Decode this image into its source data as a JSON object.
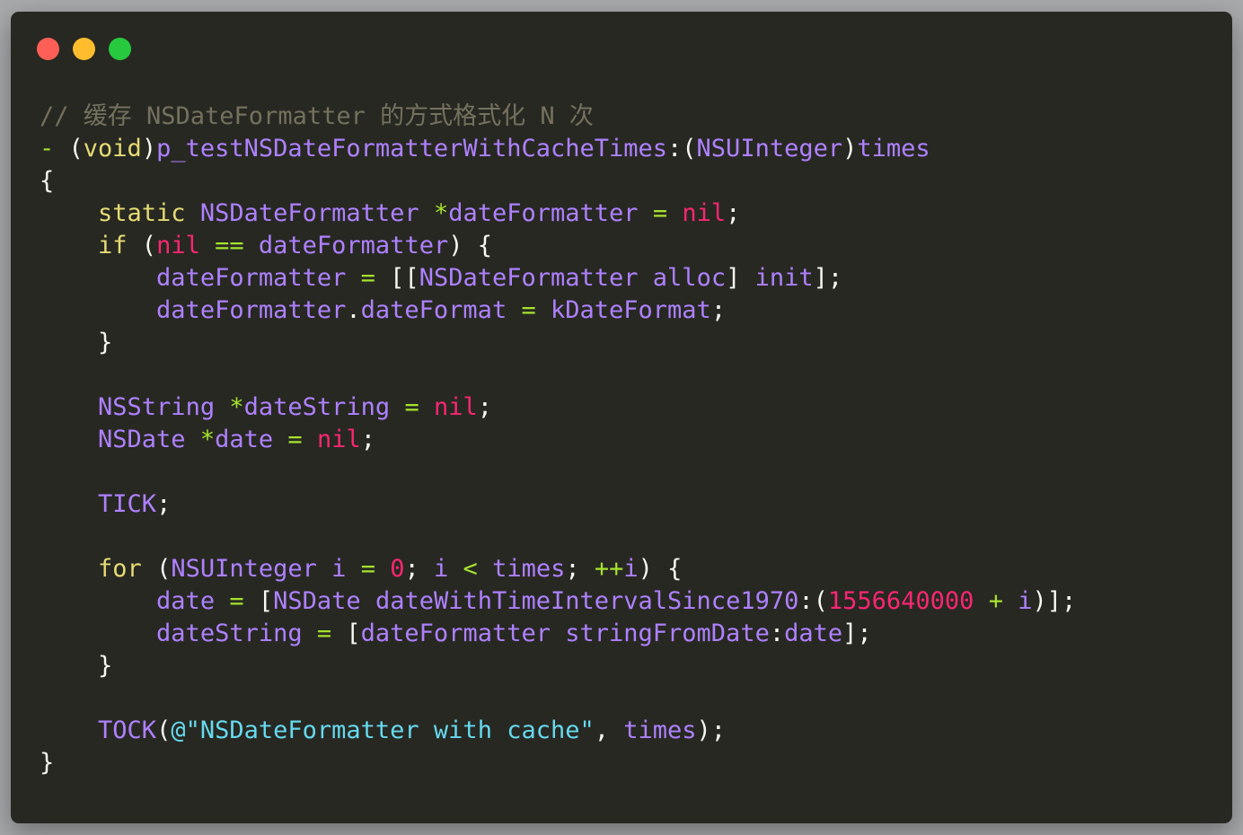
{
  "window": {
    "traffic_lights": {
      "close_color": "#ff5f56",
      "minimize_color": "#ffbd2e",
      "maximize_color": "#27c93f"
    }
  },
  "colors": {
    "background": "#272822",
    "comment": "#75715e",
    "keyword": "#e6db74",
    "storage": "#a6e22e",
    "type": "#ae81ff",
    "nil": "#f92672",
    "string": "#66d9ef",
    "default": "#f8f8f2"
  },
  "code": {
    "lines": [
      [
        {
          "t": "comment",
          "v": "// 缓存 NSDateFormatter 的方式格式化 N 次"
        }
      ],
      [
        {
          "t": "op",
          "v": "-"
        },
        {
          "t": "punct",
          "v": " ("
        },
        {
          "t": "keyword",
          "v": "void"
        },
        {
          "t": "punct",
          "v": ")"
        },
        {
          "t": "method",
          "v": "p_testNSDateFormatterWithCacheTimes"
        },
        {
          "t": "punct",
          "v": ":("
        },
        {
          "t": "type",
          "v": "NSUInteger"
        },
        {
          "t": "punct",
          "v": ")"
        },
        {
          "t": "ident",
          "v": "times"
        }
      ],
      [
        {
          "t": "punct",
          "v": "{"
        }
      ],
      [
        {
          "t": "punct",
          "v": "    "
        },
        {
          "t": "keyword",
          "v": "static"
        },
        {
          "t": "punct",
          "v": " "
        },
        {
          "t": "type",
          "v": "NSDateFormatter"
        },
        {
          "t": "punct",
          "v": " "
        },
        {
          "t": "op",
          "v": "*"
        },
        {
          "t": "ident",
          "v": "dateFormatter"
        },
        {
          "t": "punct",
          "v": " "
        },
        {
          "t": "op",
          "v": "="
        },
        {
          "t": "punct",
          "v": " "
        },
        {
          "t": "nil",
          "v": "nil"
        },
        {
          "t": "punct",
          "v": ";"
        }
      ],
      [
        {
          "t": "punct",
          "v": "    "
        },
        {
          "t": "keyword",
          "v": "if"
        },
        {
          "t": "punct",
          "v": " ("
        },
        {
          "t": "nil",
          "v": "nil"
        },
        {
          "t": "punct",
          "v": " "
        },
        {
          "t": "op",
          "v": "=="
        },
        {
          "t": "punct",
          "v": " "
        },
        {
          "t": "ident",
          "v": "dateFormatter"
        },
        {
          "t": "punct",
          "v": ") {"
        }
      ],
      [
        {
          "t": "punct",
          "v": "        "
        },
        {
          "t": "ident",
          "v": "dateFormatter"
        },
        {
          "t": "punct",
          "v": " "
        },
        {
          "t": "op",
          "v": "="
        },
        {
          "t": "punct",
          "v": " [["
        },
        {
          "t": "type",
          "v": "NSDateFormatter"
        },
        {
          "t": "punct",
          "v": " "
        },
        {
          "t": "method",
          "v": "alloc"
        },
        {
          "t": "punct",
          "v": "] "
        },
        {
          "t": "method",
          "v": "init"
        },
        {
          "t": "punct",
          "v": "];"
        }
      ],
      [
        {
          "t": "punct",
          "v": "        "
        },
        {
          "t": "ident",
          "v": "dateFormatter"
        },
        {
          "t": "punct",
          "v": "."
        },
        {
          "t": "ident",
          "v": "dateFormat"
        },
        {
          "t": "punct",
          "v": " "
        },
        {
          "t": "op",
          "v": "="
        },
        {
          "t": "punct",
          "v": " "
        },
        {
          "t": "ident",
          "v": "kDateFormat"
        },
        {
          "t": "punct",
          "v": ";"
        }
      ],
      [
        {
          "t": "punct",
          "v": "    }"
        }
      ],
      [
        {
          "t": "punct",
          "v": ""
        }
      ],
      [
        {
          "t": "punct",
          "v": "    "
        },
        {
          "t": "type",
          "v": "NSString"
        },
        {
          "t": "punct",
          "v": " "
        },
        {
          "t": "op",
          "v": "*"
        },
        {
          "t": "ident",
          "v": "dateString"
        },
        {
          "t": "punct",
          "v": " "
        },
        {
          "t": "op",
          "v": "="
        },
        {
          "t": "punct",
          "v": " "
        },
        {
          "t": "nil",
          "v": "nil"
        },
        {
          "t": "punct",
          "v": ";"
        }
      ],
      [
        {
          "t": "punct",
          "v": "    "
        },
        {
          "t": "type",
          "v": "NSDate"
        },
        {
          "t": "punct",
          "v": " "
        },
        {
          "t": "op",
          "v": "*"
        },
        {
          "t": "ident",
          "v": "date"
        },
        {
          "t": "punct",
          "v": " "
        },
        {
          "t": "op",
          "v": "="
        },
        {
          "t": "punct",
          "v": " "
        },
        {
          "t": "nil",
          "v": "nil"
        },
        {
          "t": "punct",
          "v": ";"
        }
      ],
      [
        {
          "t": "punct",
          "v": ""
        }
      ],
      [
        {
          "t": "punct",
          "v": "    "
        },
        {
          "t": "macro",
          "v": "TICK"
        },
        {
          "t": "punct",
          "v": ";"
        }
      ],
      [
        {
          "t": "punct",
          "v": ""
        }
      ],
      [
        {
          "t": "punct",
          "v": "    "
        },
        {
          "t": "keyword",
          "v": "for"
        },
        {
          "t": "punct",
          "v": " ("
        },
        {
          "t": "type",
          "v": "NSUInteger"
        },
        {
          "t": "punct",
          "v": " "
        },
        {
          "t": "ident",
          "v": "i"
        },
        {
          "t": "punct",
          "v": " "
        },
        {
          "t": "op",
          "v": "="
        },
        {
          "t": "punct",
          "v": " "
        },
        {
          "t": "number",
          "v": "0"
        },
        {
          "t": "punct",
          "v": "; "
        },
        {
          "t": "ident",
          "v": "i"
        },
        {
          "t": "punct",
          "v": " "
        },
        {
          "t": "op",
          "v": "<"
        },
        {
          "t": "punct",
          "v": " "
        },
        {
          "t": "ident",
          "v": "times"
        },
        {
          "t": "punct",
          "v": "; "
        },
        {
          "t": "op",
          "v": "++"
        },
        {
          "t": "ident",
          "v": "i"
        },
        {
          "t": "punct",
          "v": ") {"
        }
      ],
      [
        {
          "t": "punct",
          "v": "        "
        },
        {
          "t": "ident",
          "v": "date"
        },
        {
          "t": "punct",
          "v": " "
        },
        {
          "t": "op",
          "v": "="
        },
        {
          "t": "punct",
          "v": " ["
        },
        {
          "t": "type",
          "v": "NSDate"
        },
        {
          "t": "punct",
          "v": " "
        },
        {
          "t": "method",
          "v": "dateWithTimeIntervalSince1970"
        },
        {
          "t": "punct",
          "v": ":("
        },
        {
          "t": "number",
          "v": "1556640000"
        },
        {
          "t": "punct",
          "v": " "
        },
        {
          "t": "op",
          "v": "+"
        },
        {
          "t": "punct",
          "v": " "
        },
        {
          "t": "ident",
          "v": "i"
        },
        {
          "t": "punct",
          "v": ")];"
        }
      ],
      [
        {
          "t": "punct",
          "v": "        "
        },
        {
          "t": "ident",
          "v": "dateString"
        },
        {
          "t": "punct",
          "v": " "
        },
        {
          "t": "op",
          "v": "="
        },
        {
          "t": "punct",
          "v": " ["
        },
        {
          "t": "ident",
          "v": "dateFormatter"
        },
        {
          "t": "punct",
          "v": " "
        },
        {
          "t": "method",
          "v": "stringFromDate"
        },
        {
          "t": "punct",
          "v": ":"
        },
        {
          "t": "ident",
          "v": "date"
        },
        {
          "t": "punct",
          "v": "];"
        }
      ],
      [
        {
          "t": "punct",
          "v": "    }"
        }
      ],
      [
        {
          "t": "punct",
          "v": ""
        }
      ],
      [
        {
          "t": "punct",
          "v": "    "
        },
        {
          "t": "macro",
          "v": "TOCK"
        },
        {
          "t": "punct",
          "v": "("
        },
        {
          "t": "string",
          "v": "@\"NSDateFormatter with cache\""
        },
        {
          "t": "punct",
          "v": ", "
        },
        {
          "t": "ident",
          "v": "times"
        },
        {
          "t": "punct",
          "v": ");"
        }
      ],
      [
        {
          "t": "punct",
          "v": "}"
        }
      ]
    ]
  }
}
